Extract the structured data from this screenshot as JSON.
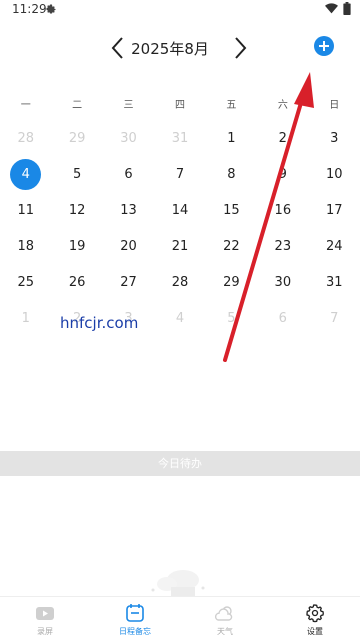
{
  "status_bar": {
    "time": "11:29",
    "icons": [
      "gear-icon",
      "wifi-icon",
      "battery-icon"
    ]
  },
  "header": {
    "month_title": "2025年8月",
    "prev_icon": "chevron-left-icon",
    "next_icon": "chevron-right-icon",
    "add_icon": "plus-circle-icon"
  },
  "weekdays": [
    "一",
    "二",
    "三",
    "四",
    "五",
    "六",
    "日"
  ],
  "calendar": {
    "today": "4",
    "weeks": [
      [
        {
          "d": "28",
          "m": true
        },
        {
          "d": "29",
          "m": true
        },
        {
          "d": "30",
          "m": true
        },
        {
          "d": "31",
          "m": true
        },
        {
          "d": "1",
          "m": false
        },
        {
          "d": "2",
          "m": false
        },
        {
          "d": "3",
          "m": false
        }
      ],
      [
        {
          "d": "4",
          "m": false,
          "today": true
        },
        {
          "d": "5",
          "m": false
        },
        {
          "d": "6",
          "m": false
        },
        {
          "d": "7",
          "m": false
        },
        {
          "d": "8",
          "m": false
        },
        {
          "d": "9",
          "m": false
        },
        {
          "d": "10",
          "m": false
        }
      ],
      [
        {
          "d": "11",
          "m": false
        },
        {
          "d": "12",
          "m": false
        },
        {
          "d": "13",
          "m": false
        },
        {
          "d": "14",
          "m": false
        },
        {
          "d": "15",
          "m": false
        },
        {
          "d": "16",
          "m": false
        },
        {
          "d": "17",
          "m": false
        }
      ],
      [
        {
          "d": "18",
          "m": false
        },
        {
          "d": "19",
          "m": false
        },
        {
          "d": "20",
          "m": false
        },
        {
          "d": "21",
          "m": false
        },
        {
          "d": "22",
          "m": false
        },
        {
          "d": "23",
          "m": false
        },
        {
          "d": "24",
          "m": false
        }
      ],
      [
        {
          "d": "25",
          "m": false
        },
        {
          "d": "26",
          "m": false
        },
        {
          "d": "27",
          "m": false
        },
        {
          "d": "28",
          "m": false
        },
        {
          "d": "29",
          "m": false
        },
        {
          "d": "30",
          "m": false
        },
        {
          "d": "31",
          "m": false
        }
      ],
      [
        {
          "d": "1",
          "m": true
        },
        {
          "d": "2",
          "m": true
        },
        {
          "d": "3",
          "m": true
        },
        {
          "d": "4",
          "m": true
        },
        {
          "d": "5",
          "m": true
        },
        {
          "d": "6",
          "m": true
        },
        {
          "d": "7",
          "m": true
        }
      ]
    ]
  },
  "watermark": "hnfcjr.com",
  "todo_section": {
    "label": "今日待办"
  },
  "tabs": [
    {
      "label": "录屏",
      "icon": "video-play-icon"
    },
    {
      "label": "日程备忘",
      "icon": "calendar-icon"
    },
    {
      "label": "天气",
      "icon": "weather-icon"
    },
    {
      "label": "设置",
      "icon": "gear-icon"
    }
  ],
  "colors": {
    "accent": "#1a88e6",
    "annotation_arrow": "#d8202a",
    "muted_text": "#cfcfcf",
    "todo_bar": "#e3e3e3"
  }
}
